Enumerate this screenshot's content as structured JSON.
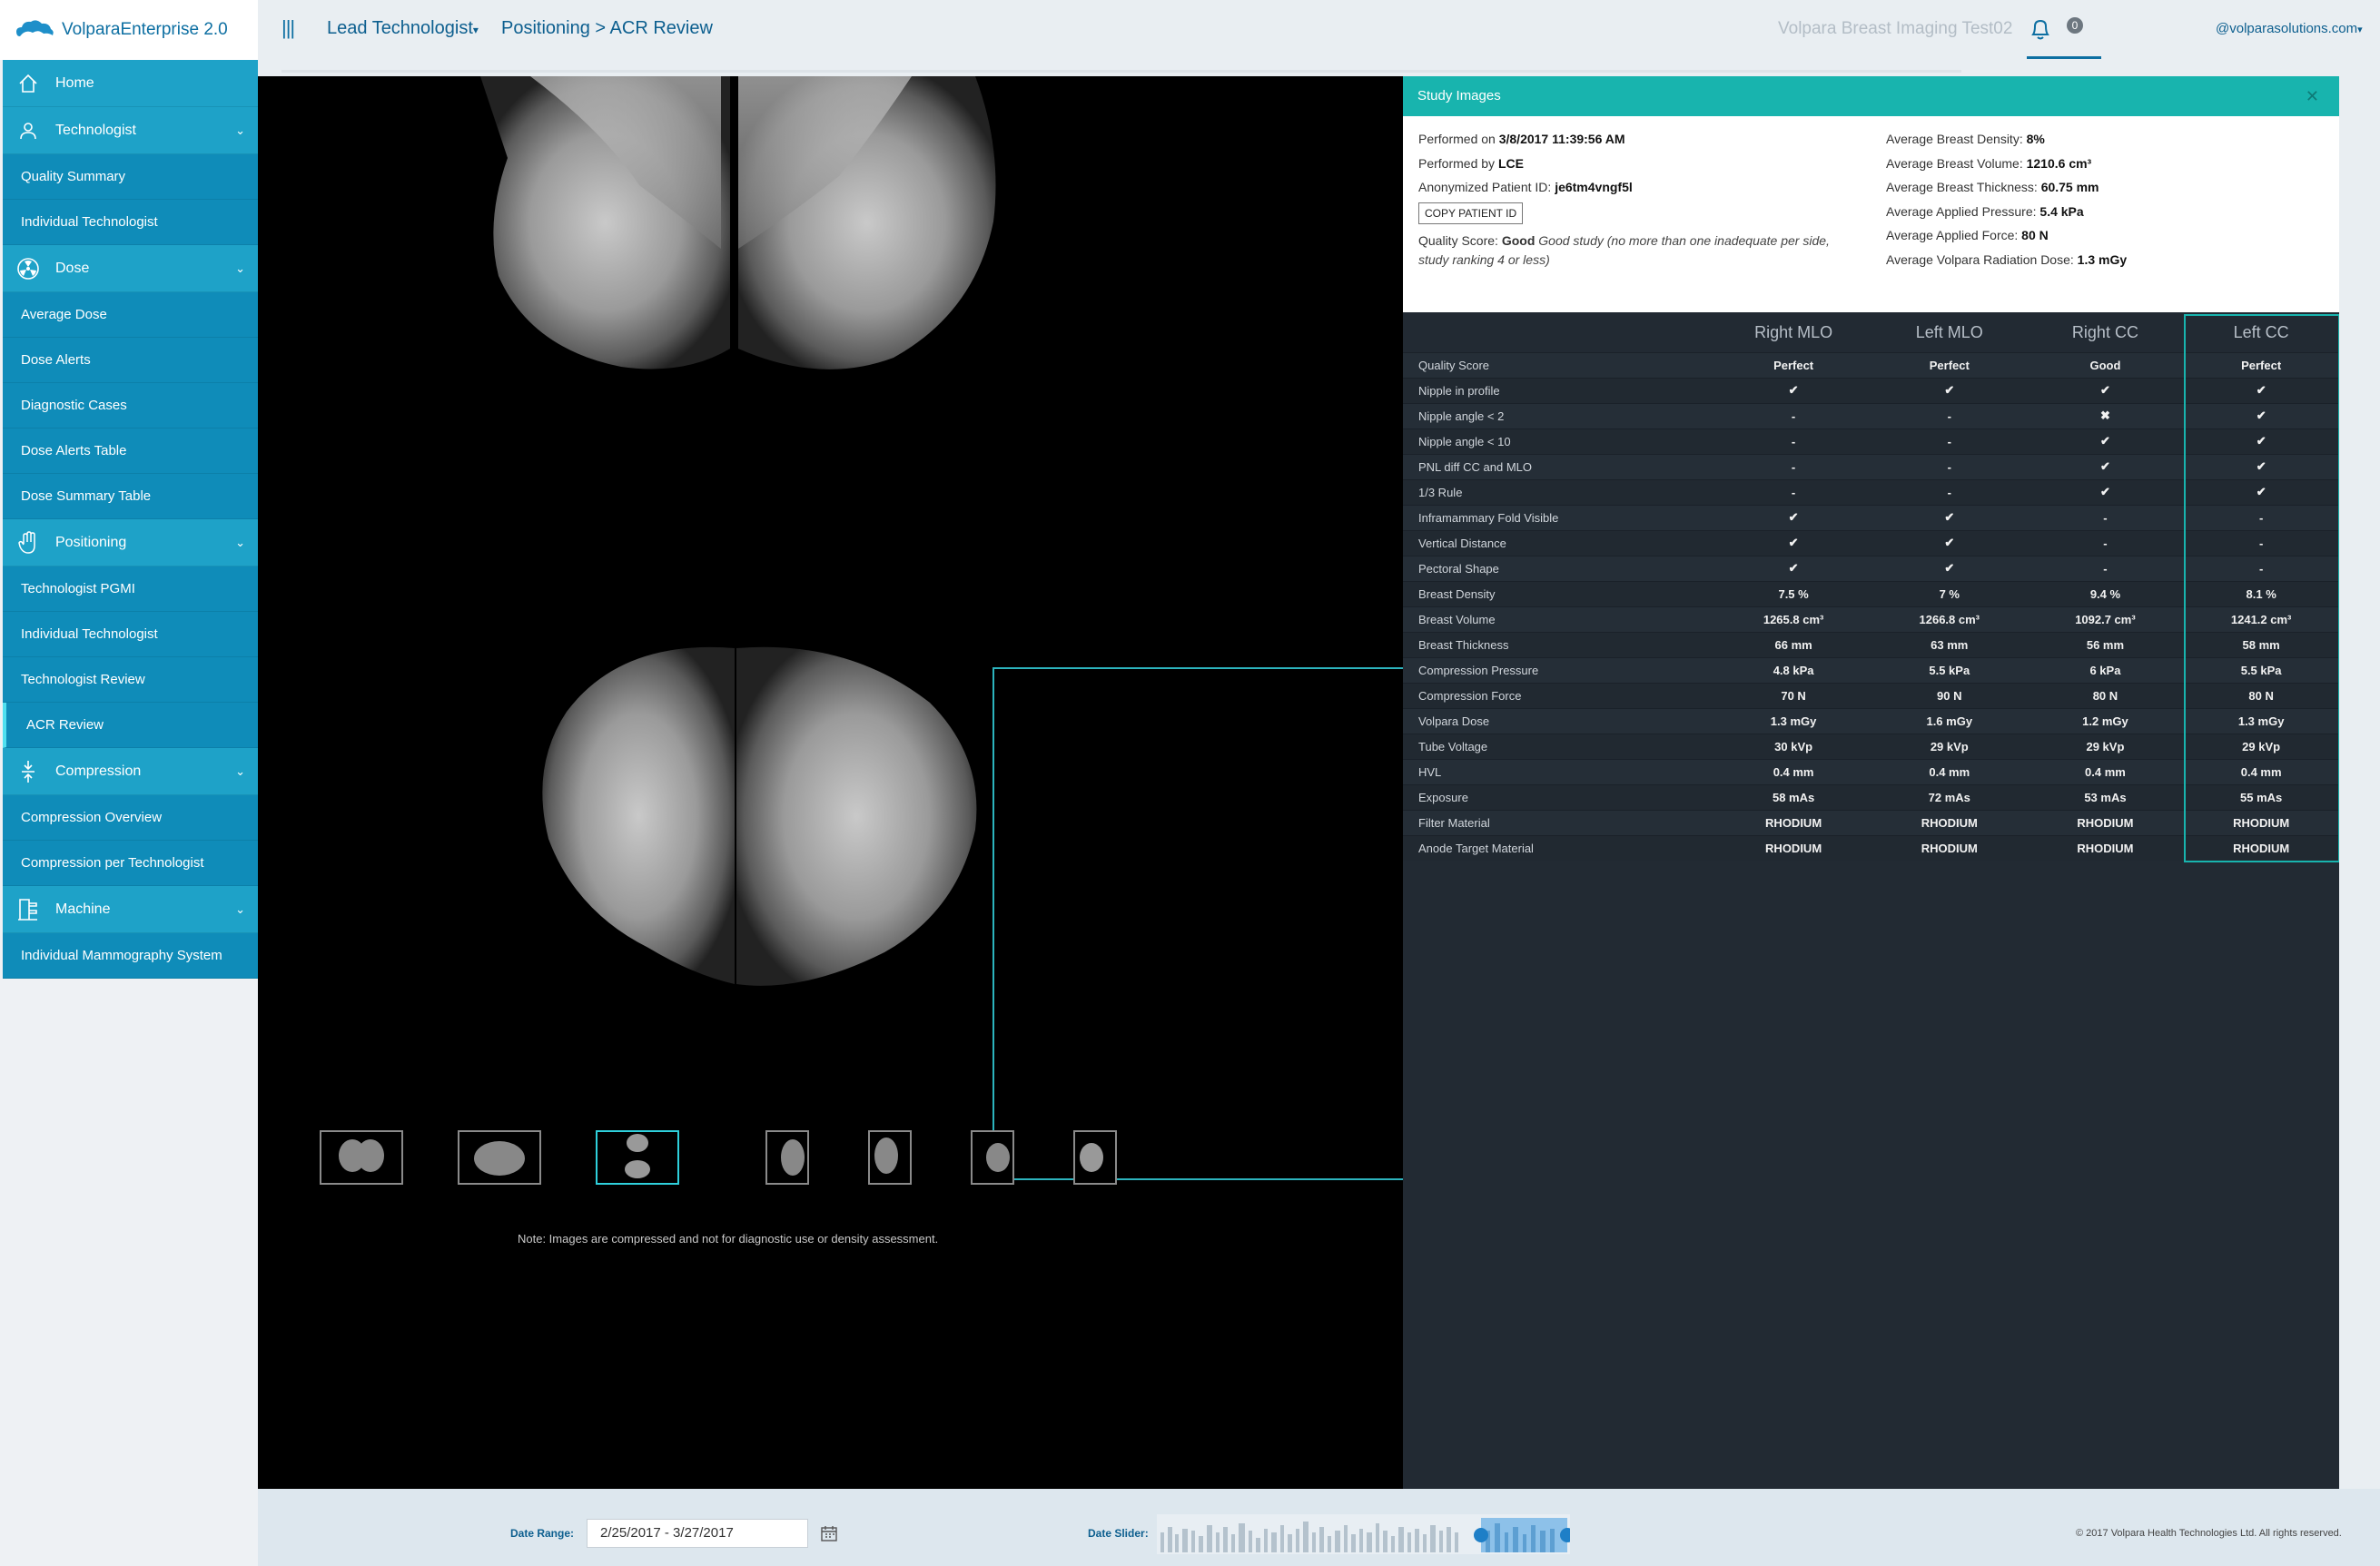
{
  "app": {
    "title": "VolparaEnterprise 2.0",
    "site": "Volpara Breast Imaging Test02",
    "user": "@volparasolutions.com",
    "notifications": "0"
  },
  "header": {
    "role": "Lead Technologist",
    "breadcrumb": "Positioning > ACR Review"
  },
  "sidebar": {
    "home": "Home",
    "sections": [
      {
        "label": "Technologist",
        "items": [
          "Quality Summary",
          "Individual Technologist"
        ]
      },
      {
        "label": "Dose",
        "items": [
          "Average Dose",
          "Dose Alerts",
          "Diagnostic Cases",
          "Dose Alerts Table",
          "Dose Summary Table"
        ]
      },
      {
        "label": "Positioning",
        "items": [
          "Technologist PGMI",
          "Individual Technologist",
          "Technologist Review",
          "ACR Review"
        ]
      },
      {
        "label": "Compression",
        "items": [
          "Compression Overview",
          "Compression per Technologist"
        ]
      },
      {
        "label": "Machine",
        "items": [
          "Individual Mammography System"
        ]
      }
    ]
  },
  "viewer": {
    "note": "Note: Images are compressed and not for diagnostic use or density assessment."
  },
  "panel": {
    "title": "Study Images",
    "performed_on_label": "Performed on ",
    "performed_on": "3/8/2017 11:39:56 AM",
    "performed_by_label": "Performed by ",
    "performed_by": "LCE",
    "patient_id_label": "Anonymized Patient ID: ",
    "patient_id": "je6tm4vngf5l",
    "copy_button": "COPY PATIENT ID",
    "quality_label": "Quality Score: ",
    "quality": "Good",
    "quality_note": "Good study (no more than one inadequate per side, study ranking 4 or less)",
    "averages": [
      {
        "label": "Average Breast Density: ",
        "value": "8%"
      },
      {
        "label": "Average Breast Volume: ",
        "value": "1210.6 cm³"
      },
      {
        "label": "Average Breast Thickness: ",
        "value": "60.75 mm"
      },
      {
        "label": "Average Applied Pressure: ",
        "value": "5.4 kPa"
      },
      {
        "label": "Average Applied Force: ",
        "value": "80 N"
      },
      {
        "label": "Average Volpara Radiation Dose: ",
        "value": "1.3 mGy"
      }
    ],
    "columns": [
      "Right MLO",
      "Left MLO",
      "Right CC",
      "Left CC"
    ],
    "rows": [
      [
        "Quality Score",
        "Perfect",
        "Perfect",
        "Good",
        "Perfect"
      ],
      [
        "Nipple in profile",
        "✔",
        "✔",
        "✔",
        "✔"
      ],
      [
        "Nipple angle < 2",
        "-",
        "-",
        "✖",
        "✔"
      ],
      [
        "Nipple angle < 10",
        "-",
        "-",
        "✔",
        "✔"
      ],
      [
        "PNL diff CC and MLO",
        "-",
        "-",
        "✔",
        "✔"
      ],
      [
        "1/3 Rule",
        "-",
        "-",
        "✔",
        "✔"
      ],
      [
        "Inframammary Fold Visible",
        "✔",
        "✔",
        "-",
        "-"
      ],
      [
        "Vertical Distance",
        "✔",
        "✔",
        "-",
        "-"
      ],
      [
        "Pectoral Shape",
        "✔",
        "✔",
        "-",
        "-"
      ],
      [
        "Breast Density",
        "7.5 %",
        "7 %",
        "9.4 %",
        "8.1 %"
      ],
      [
        "Breast Volume",
        "1265.8 cm³",
        "1266.8 cm³",
        "1092.7 cm³",
        "1241.2 cm³"
      ],
      [
        "Breast Thickness",
        "66 mm",
        "63 mm",
        "56 mm",
        "58 mm"
      ],
      [
        "Compression Pressure",
        "4.8 kPa",
        "5.5 kPa",
        "6 kPa",
        "5.5 kPa"
      ],
      [
        "Compression Force",
        "70 N",
        "90 N",
        "80 N",
        "80 N"
      ],
      [
        "Volpara Dose",
        "1.3 mGy",
        "1.6 mGy",
        "1.2 mGy",
        "1.3 mGy"
      ],
      [
        "Tube Voltage",
        "30 kVp",
        "29 kVp",
        "29 kVp",
        "29 kVp"
      ],
      [
        "HVL",
        "0.4 mm",
        "0.4 mm",
        "0.4 mm",
        "0.4 mm"
      ],
      [
        "Exposure",
        "58 mAs",
        "72 mAs",
        "53 mAs",
        "55 mAs"
      ],
      [
        "Filter Material",
        "RHODIUM",
        "RHODIUM",
        "RHODIUM",
        "RHODIUM"
      ],
      [
        "Anode Target Material",
        "RHODIUM",
        "RHODIUM",
        "RHODIUM",
        "RHODIUM"
      ]
    ]
  },
  "footer": {
    "date_range_label": "Date Range:",
    "date_range": "2/25/2017 - 3/27/2017",
    "date_slider_label": "Date Slider:",
    "copyright": "© 2017 Volpara Health Technologies Ltd. All rights reserved."
  },
  "colors": {
    "accent": "#1ea2c8",
    "nav_dark": "#0f8cb9",
    "teal": "#18b4ae",
    "panel_bg": "#222a33"
  }
}
